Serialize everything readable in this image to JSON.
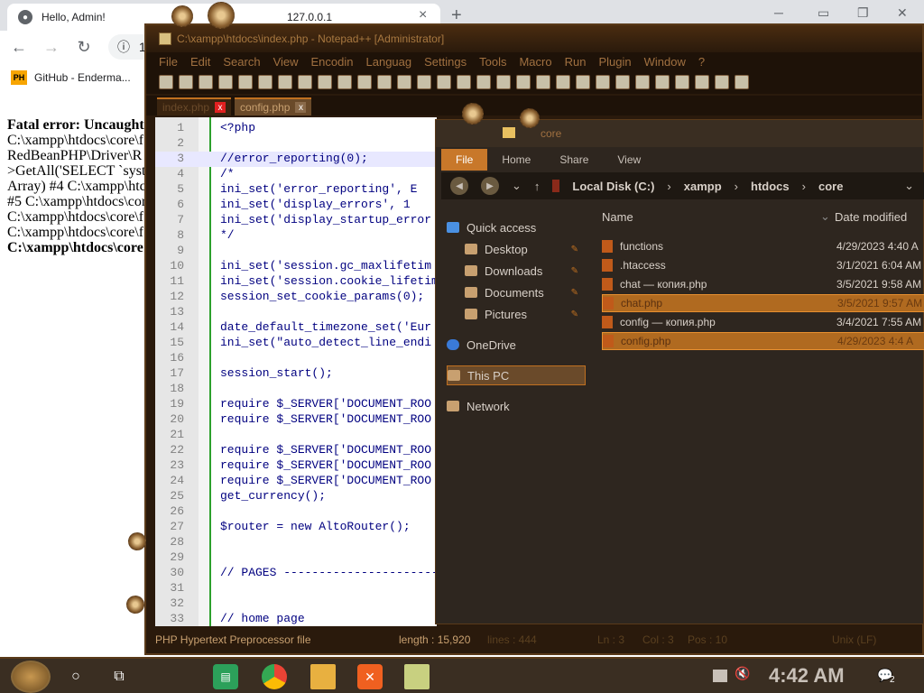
{
  "browser": {
    "tab_title": "Hello, Admin!",
    "tab_title_partial": "127.0.0.1",
    "tab_close": "×",
    "new_tab": "+",
    "address_partial": "127",
    "bookmark_label": "GitHub - Enderma...",
    "bookmark_badge": "PH"
  },
  "page": {
    "lines": [
      "Fatal error: Uncaught",
      "C:\\xampp\\htdocs\\core\\f",
      "RedBeanPHP\\Driver\\R",
      ">GetAll('SELECT `syst",
      "Array) #4 C:\\xampp\\htc",
      "#5 C:\\xampp\\htdocs\\cor",
      "C:\\xampp\\htdocs\\core\\f",
      "C:\\xampp\\htdocs\\core\\f",
      "C:\\xampp\\htdocs\\core"
    ]
  },
  "npp": {
    "title": "C:\\xampp\\htdocs\\index.php - Notepad++ [Administrator]",
    "menu": [
      "File",
      "Edit",
      "Search",
      "View",
      "Encodin",
      "Languag",
      "Settings",
      "Tools",
      "Macro",
      "Run",
      "Plugin",
      "Window",
      "?"
    ],
    "tabs": [
      {
        "label": "index.php",
        "close": "x"
      },
      {
        "label": "config.php",
        "close": "x"
      }
    ],
    "lines": [
      {
        "n": "1",
        "code": "<?php",
        "cls": "c-php"
      },
      {
        "n": "2",
        "code": "",
        "cls": ""
      },
      {
        "n": "3",
        "code": "//error_reporting(0);",
        "cls": "c-cm"
      },
      {
        "n": "4",
        "code": "/*",
        "cls": "c-cm"
      },
      {
        "n": "5",
        "code": "ini_set('error_reporting', E",
        "cls": "c-kw"
      },
      {
        "n": "6",
        "code": "ini_set('display_errors', 1",
        "cls": "c-kw"
      },
      {
        "n": "7",
        "code": "ini_set('display_startup_error",
        "cls": "c-kw"
      },
      {
        "n": "8",
        "code": "*/",
        "cls": "c-cm"
      },
      {
        "n": "9",
        "code": "",
        "cls": ""
      },
      {
        "n": "10",
        "code": "ini_set('session.gc_maxlifetim",
        "cls": "c-kw"
      },
      {
        "n": "11",
        "code": "ini_set('session.cookie_lifetim",
        "cls": "c-kw"
      },
      {
        "n": "12",
        "code": "session_set_cookie_params(0);",
        "cls": "c-kw"
      },
      {
        "n": "13",
        "code": "",
        "cls": ""
      },
      {
        "n": "14",
        "code": "date_default_timezone_set('Eur",
        "cls": "c-kw"
      },
      {
        "n": "15",
        "code": "ini_set(\"auto_detect_line_endi",
        "cls": "c-kw"
      },
      {
        "n": "16",
        "code": "",
        "cls": ""
      },
      {
        "n": "17",
        "code": "session_start();",
        "cls": "c-kw"
      },
      {
        "n": "18",
        "code": "",
        "cls": ""
      },
      {
        "n": "19",
        "code": "require $_SERVER['DOCUMENT_ROO",
        "cls": "c-kw"
      },
      {
        "n": "20",
        "code": "require $_SERVER['DOCUMENT_ROO",
        "cls": "c-kw"
      },
      {
        "n": "21",
        "code": "",
        "cls": ""
      },
      {
        "n": "22",
        "code": "require $_SERVER['DOCUMENT_ROO",
        "cls": "c-kw"
      },
      {
        "n": "23",
        "code": "require $_SERVER['DOCUMENT_ROO",
        "cls": "c-kw"
      },
      {
        "n": "24",
        "code": "require $_SERVER['DOCUMENT_ROO",
        "cls": "c-kw"
      },
      {
        "n": "25",
        "code": "get_currency();",
        "cls": "c-kw"
      },
      {
        "n": "26",
        "code": "",
        "cls": ""
      },
      {
        "n": "27",
        "code": "$router = new AltoRouter();",
        "cls": "c-kw"
      },
      {
        "n": "28",
        "code": "",
        "cls": ""
      },
      {
        "n": "29",
        "code": "",
        "cls": ""
      },
      {
        "n": "30",
        "code": "// PAGES -------------------------",
        "cls": "c-cm"
      },
      {
        "n": "31",
        "code": "",
        "cls": ""
      },
      {
        "n": "32",
        "code": "",
        "cls": ""
      },
      {
        "n": "33",
        "code": "// home page",
        "cls": "c-cm"
      }
    ],
    "status": {
      "type": "PHP Hypertext Preprocessor file",
      "length": "length : 15,920",
      "lines": "lines : 444",
      "ln": "Ln : 3",
      "col": "Col : 3",
      "pos": "Pos : 10",
      "eol": "Unix (LF)"
    }
  },
  "explorer": {
    "title": "core",
    "ribbon": [
      "File",
      "Home",
      "Share",
      "View"
    ],
    "breadcrumb": [
      "Local Disk (C:)",
      "xampp",
      "htdocs",
      "core"
    ],
    "nav": [
      {
        "label": "Quick access",
        "sub": false,
        "sel": false,
        "icon": "star",
        "pin": false
      },
      {
        "label": "Desktop",
        "sub": true,
        "sel": false,
        "icon": "folder",
        "pin": true
      },
      {
        "label": "Downloads",
        "sub": true,
        "sel": false,
        "icon": "folder",
        "pin": true
      },
      {
        "label": "Documents",
        "sub": true,
        "sel": false,
        "icon": "folder",
        "pin": true
      },
      {
        "label": "Pictures",
        "sub": true,
        "sel": false,
        "icon": "folder",
        "pin": true
      },
      {
        "label": "OneDrive",
        "sub": false,
        "sel": false,
        "icon": "cloud",
        "pin": false
      },
      {
        "label": "This PC",
        "sub": false,
        "sel": true,
        "icon": "folder",
        "pin": false
      },
      {
        "label": "Network",
        "sub": false,
        "sel": false,
        "icon": "folder",
        "pin": false
      }
    ],
    "columns": [
      "Name",
      "Date modified"
    ],
    "files": [
      {
        "name": "functions",
        "date": "4/29/2023 4:40 A",
        "sel": false
      },
      {
        "name": ".htaccess",
        "date": "3/1/2021 6:04 AM",
        "sel": false
      },
      {
        "name": "chat — копия.php",
        "date": "3/5/2021 9:58 AM",
        "sel": false
      },
      {
        "name": "chat.php",
        "date": "3/5/2021 9:57 AM",
        "sel": true
      },
      {
        "name": "config — копия.php",
        "date": "3/4/2021 7:55 AM",
        "sel": false
      },
      {
        "name": "config.php",
        "date": "4/29/2023 4:4 A",
        "sel": true
      }
    ]
  },
  "taskbar": {
    "time": "4:42 AM",
    "notif_count": "2"
  }
}
